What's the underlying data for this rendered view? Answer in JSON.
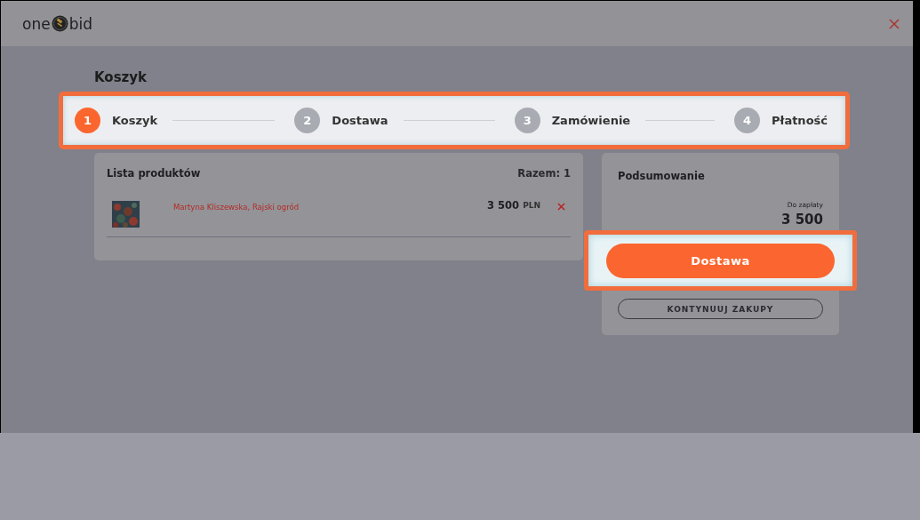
{
  "header": {
    "logo_left": "one",
    "logo_right": "bid"
  },
  "page_title": "Koszyk",
  "steps": [
    {
      "number": "1",
      "label": "Koszyk",
      "selected": true
    },
    {
      "number": "2",
      "label": "Dostawa",
      "selected": false
    },
    {
      "number": "3",
      "label": "Zamówienie",
      "selected": false
    },
    {
      "number": "4",
      "label": "Płatność",
      "selected": false
    }
  ],
  "products": {
    "title": "Lista produktów",
    "total": "Razem: 1",
    "items": [
      {
        "name": "Martyna Kliszewska, Rajski ogród",
        "price": "3 500",
        "currency": "PLN"
      }
    ]
  },
  "summary": {
    "title": "Podsumowanie",
    "due_label": "Do zapłaty",
    "due_amount": "3 500",
    "primary_button": "Dostawa",
    "secondary_button": "KONTYNUUJ ZAKUPY"
  }
}
